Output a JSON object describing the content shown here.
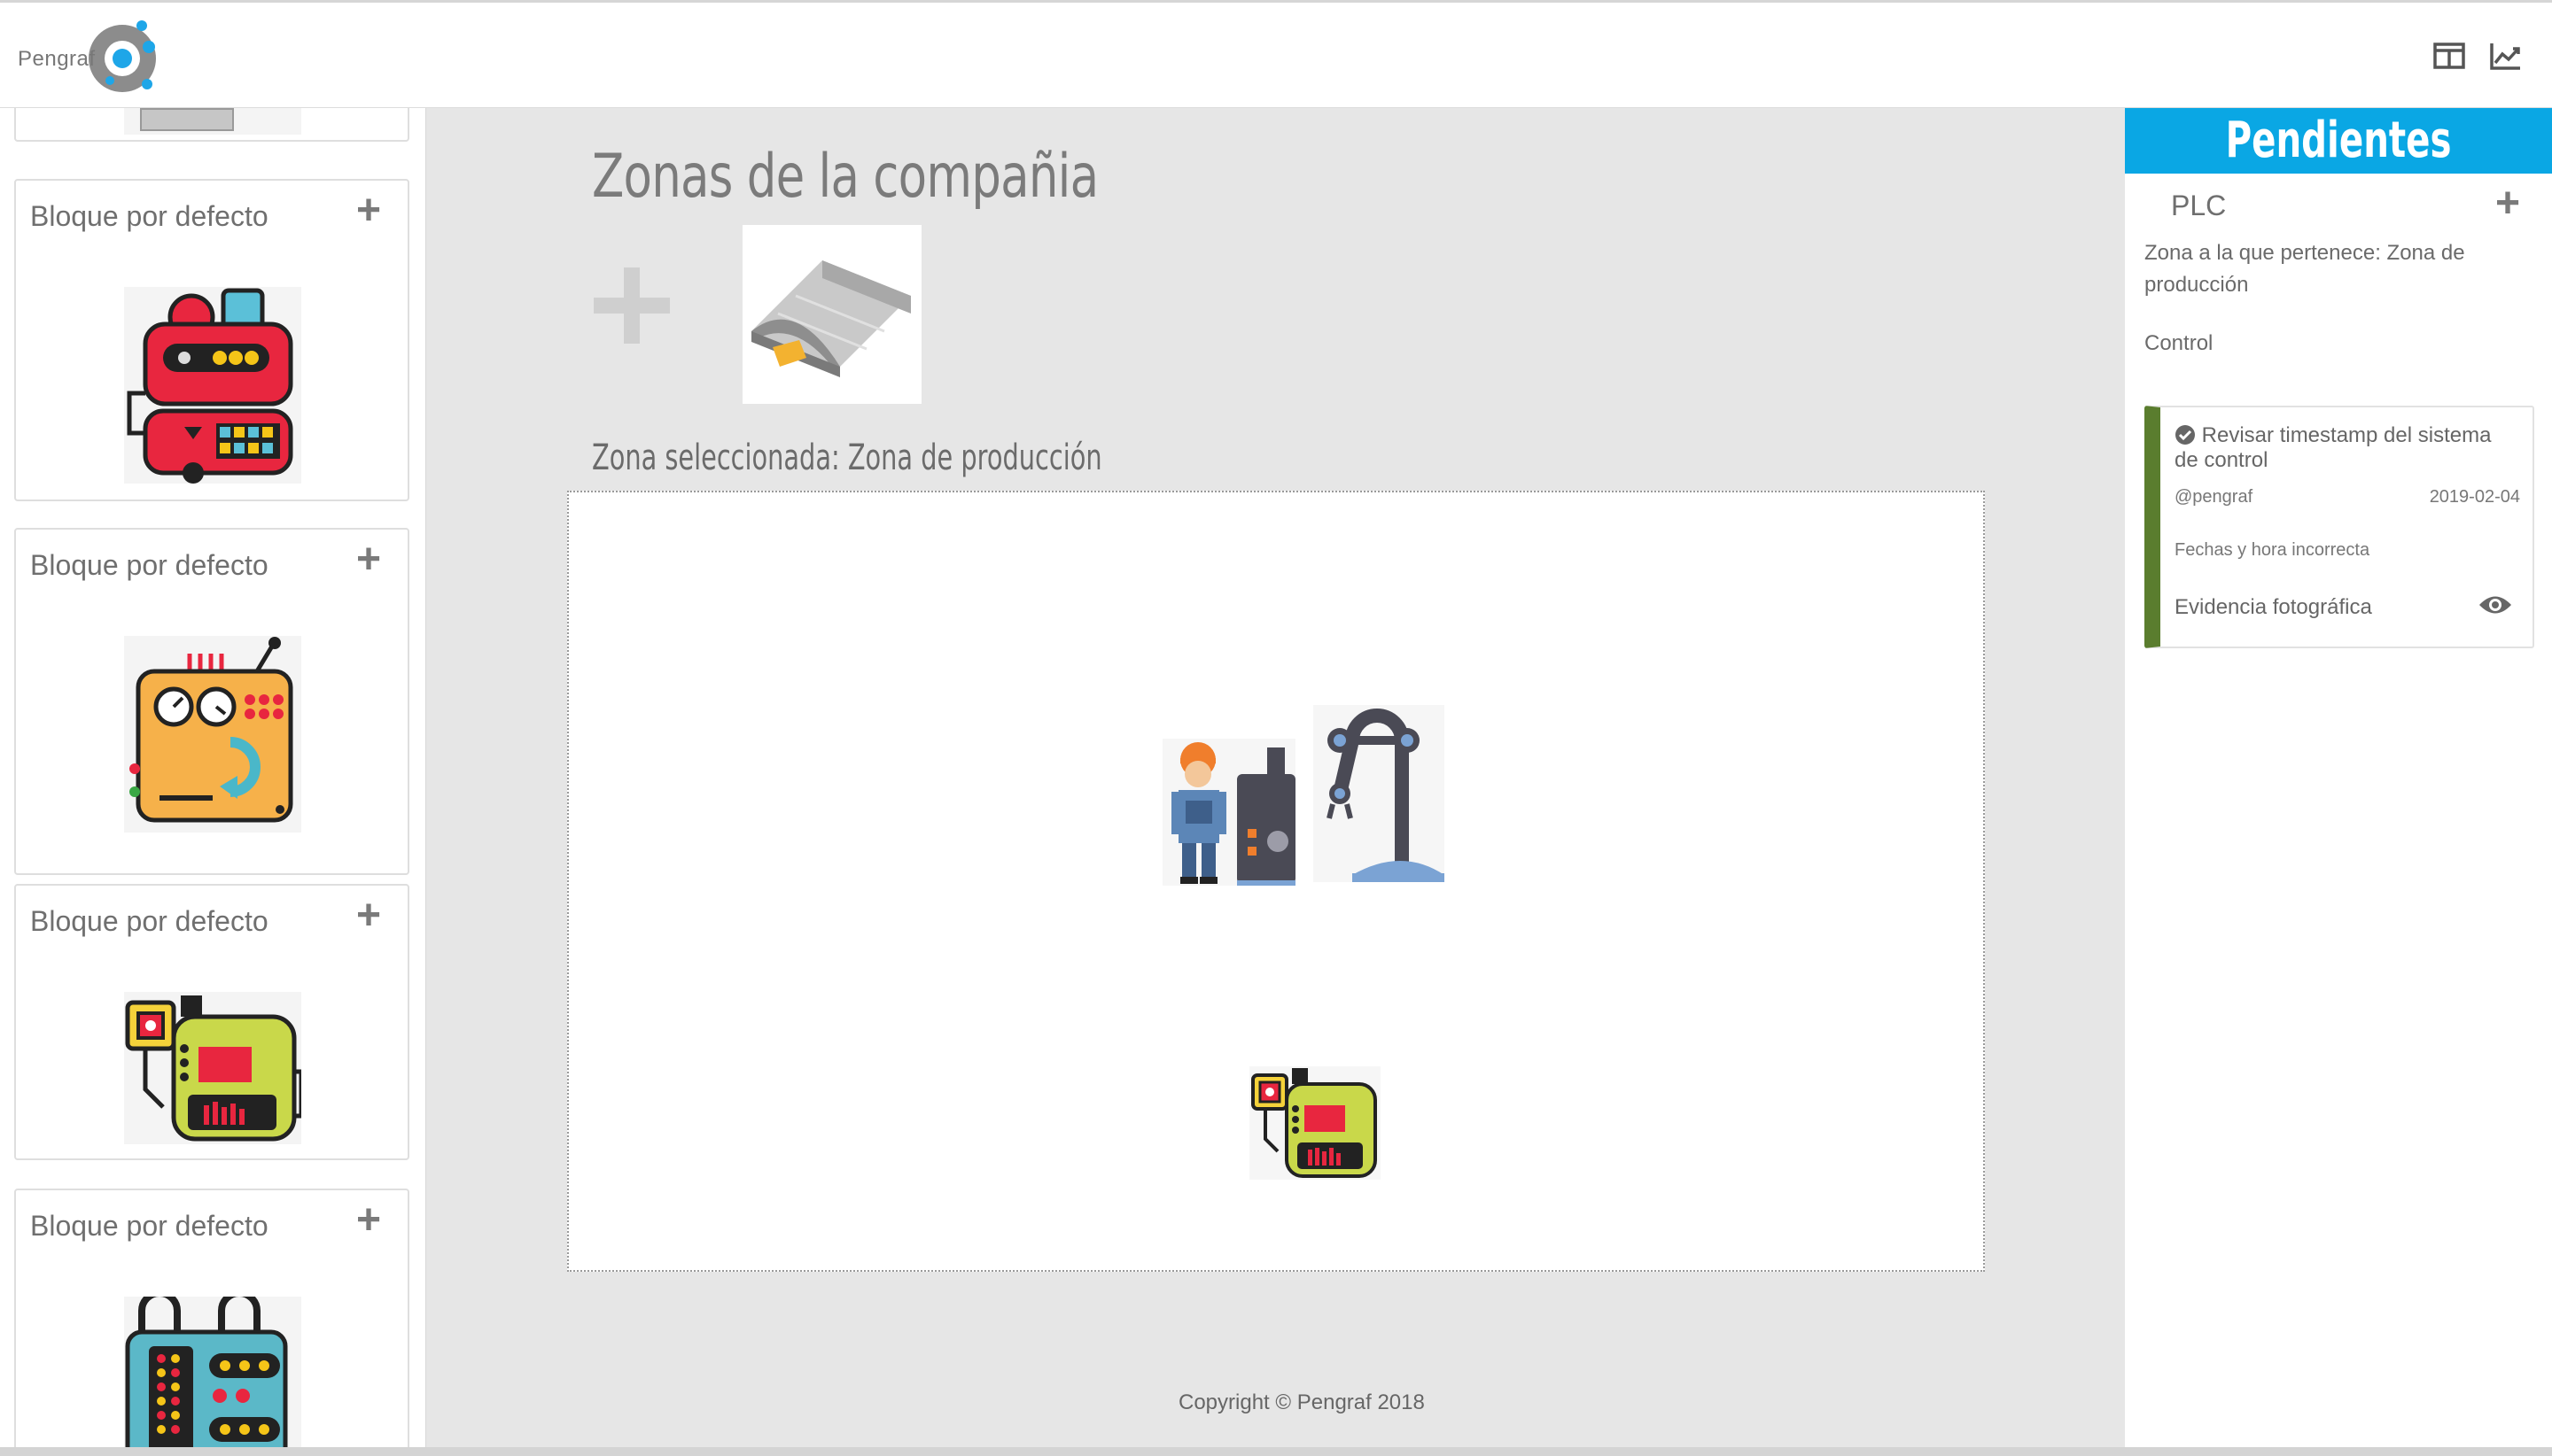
{
  "app": {
    "logo_text": "Pengraf",
    "top_icons": [
      "layout-columns-icon",
      "line-chart-icon"
    ]
  },
  "sidebar": {
    "blocks": [
      {
        "label": "Bloque por defecto",
        "icon": "red-robot-icon"
      },
      {
        "label": "Bloque por defecto",
        "icon": "orange-machine-icon"
      },
      {
        "label": "Bloque por defecto",
        "icon": "yellow-robot-icon"
      },
      {
        "label": "Bloque por defecto",
        "icon": "teal-robot-icon"
      }
    ]
  },
  "main": {
    "title": "Zonas de la compañia",
    "selected_zone_label": "Zona seleccionada: Zona de producción",
    "zones": [
      {
        "icon": "warehouse-icon"
      }
    ],
    "canvas_items": [
      "worker-machine-icon",
      "robot-arm-icon",
      "yellow-robot-icon"
    ],
    "copyright": "Copyright © Pengraf 2018"
  },
  "pending": {
    "header": "Pendientes",
    "device": {
      "name": "PLC",
      "zone_text": "Zona a la que pertenece: Zona de producción",
      "category": "Control"
    },
    "task": {
      "title": "Revisar timestamp del sistema de control",
      "user": "@pengraf",
      "date": "2019-02-04",
      "description": "Fechas y hora incorrecta",
      "evidence_label": "Evidencia fotográfica"
    }
  },
  "colors": {
    "accent": "#0aa7e4",
    "task_status": "#5a7d2e",
    "background": "#e6e6e6"
  }
}
